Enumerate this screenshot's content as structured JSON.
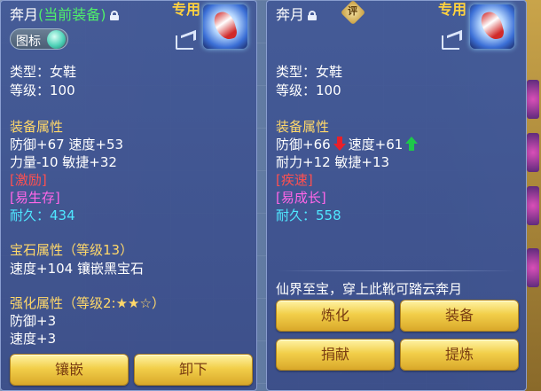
{
  "left_panel": {
    "item_name": "奔月",
    "equipped_tag": "(当前装备)",
    "exclusive_label": "专用",
    "badge_label": "图标",
    "type_line": "类型：女鞋",
    "level_line": "等级：100",
    "equip_attr_header": "装备属性",
    "attr_line1": "防御+67 速度+53",
    "attr_line2": "力量-10 敏捷+32",
    "special_effect": "[激励]",
    "special_skill": "[易生存]",
    "durability_line": "耐久：434",
    "gem_header": "宝石属性（等级13）",
    "gem_line": "速度+104 镶嵌黑宝石",
    "enhance_header": "强化属性（等级2:★★☆）",
    "enhance_line1": "防御+3",
    "enhance_line2": "速度+3",
    "buttons": {
      "inlay": "镶嵌",
      "unequip": "卸下"
    }
  },
  "right_panel": {
    "item_name": "奔月",
    "rating_badge": "评",
    "exclusive_label": "专用",
    "type_line": "类型：女鞋",
    "level_line": "等级：100",
    "equip_attr_header": "装备属性",
    "attr_defense": "防御+66",
    "attr_speed": "速度+61",
    "attr_line2": "耐力+12 敏捷+13",
    "special_effect": "[疾速]",
    "special_skill": "[易成长]",
    "durability_line": "耐久：558",
    "description": "仙界至宝，穿上此靴可踏云奔月",
    "buttons": {
      "refine": "炼化",
      "equip": "装备",
      "donate": "捐献",
      "extract": "提炼"
    }
  },
  "colors": {
    "header": "#ffd86a",
    "green_equipped": "#4ff06a",
    "red_effect": "#ff5050",
    "pink_skill": "#ff66e8",
    "cyan_durability": "#4fe7ff",
    "button_text": "#7a3d12",
    "stat_down": "#e8202a",
    "stat_up": "#1ec84a"
  },
  "icons": [
    "lock-icon",
    "share-icon",
    "item-boots-icon",
    "gem-orb-icon",
    "arrow-down-icon",
    "arrow-up-icon"
  ]
}
